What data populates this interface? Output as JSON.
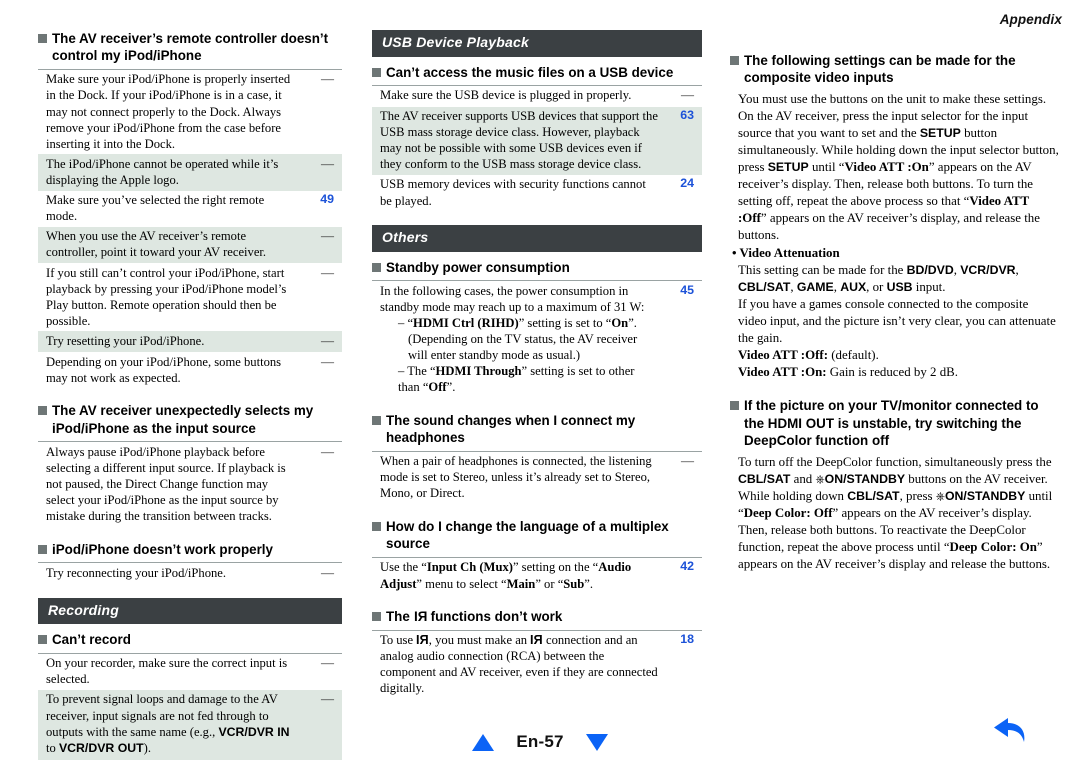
{
  "page": {
    "running_header": "Appendix",
    "page_label": "En-57",
    "nav_prev_icon": "triangle-up-icon",
    "nav_next_icon": "triangle-down-icon",
    "back_icon": "back-arrow-icon",
    "accent_blue": "#0b63f6",
    "ref_link_blue": "#1c52d8",
    "band_bg": "#3b4043",
    "row_shade": "#dee7e1",
    "bullet_square": "#6e7676"
  },
  "column1": {
    "q1": {
      "heading": "The AV receiver’s remote controller doesn’t control my iPod/iPhone",
      "rows": [
        {
          "text": "Make sure your iPod/iPhone is properly inserted in the Dock. If your iPod/iPhone is in a case, it may not connect properly to the Dock. Always remove your iPod/iPhone from the case before inserting it into the Dock.",
          "ref": "—",
          "shade": false
        },
        {
          "text": "The iPod/iPhone cannot be operated while it’s displaying the Apple logo.",
          "ref": "—",
          "shade": true
        },
        {
          "text": "Make sure you’ve selected the right remote mode.",
          "ref": "49",
          "shade": false
        },
        {
          "text": "When you use the AV receiver’s remote controller, point it toward your AV receiver.",
          "ref": "—",
          "shade": true
        },
        {
          "text": "If you still can’t control your iPod/iPhone, start playback by pressing your iPod/iPhone model’s Play button. Remote operation should then be possible.",
          "ref": "—",
          "shade": false
        },
        {
          "text": "Try resetting your iPod/iPhone.",
          "ref": "—",
          "shade": true
        },
        {
          "text": "Depending on your iPod/iPhone, some buttons may not work as expected.",
          "ref": "—",
          "shade": false
        }
      ]
    },
    "q2": {
      "heading": "The AV receiver unexpectedly selects my iPod/iPhone as the input source",
      "rows": [
        {
          "text": "Always pause iPod/iPhone playback before selecting a different input source. If playback is not paused, the Direct Change function may select your iPod/iPhone as the input source by mistake during the transition between tracks.",
          "ref": "—",
          "shade": false
        }
      ]
    },
    "q3": {
      "heading": "iPod/iPhone doesn’t work properly",
      "rows": [
        {
          "text": "Try reconnecting your iPod/iPhone.",
          "ref": "—",
          "shade": false
        }
      ]
    },
    "section_recording": "Recording",
    "q4": {
      "heading": "Can’t record",
      "rows": [
        {
          "text": "On your recorder, make sure the correct input is selected.",
          "ref": "—",
          "shade": false
        }
      ]
    },
    "q4_row2": {
      "prefix": "To prevent signal loops and damage to the AV receiver, input signals are not fed through to outputs with the same name (e.g., ",
      "bold1": "VCR/DVR IN",
      "mid": " to ",
      "bold2": "VCR/DVR OUT",
      "suffix": ").",
      "ref": "—"
    }
  },
  "column2": {
    "section_usb": "USB Device Playback",
    "q1": {
      "heading": "Can’t access the music files on a USB device",
      "rows": [
        {
          "text": "Make sure the USB device is plugged in properly.",
          "ref": "—",
          "shade": false
        },
        {
          "text": "The AV receiver supports USB devices that support the USB mass storage device class. However, playback may not be possible with some USB devices even if they conform to the USB mass storage device class.",
          "ref": "63",
          "shade": true
        },
        {
          "text": "USB memory devices with security functions cannot be played.",
          "ref": "24",
          "shade": false
        }
      ]
    },
    "section_others": "Others",
    "q2": {
      "heading": "Standby power consumption",
      "ref": "45",
      "line1": "In the following cases, the power consumption in standby mode may reach up to a maximum of 31 W:",
      "dash1_pre": "– “",
      "dash1_bold": "HDMI Ctrl (RIHD)",
      "dash1_post": "” setting is set to “",
      "dash1_bold2": "On",
      "dash1_end": "”.",
      "dash1_note": "(Depending on the TV status, the AV receiver will enter standby mode as usual.)",
      "dash2_pre": "– The “",
      "dash2_bold": "HDMI Through",
      "dash2_post": "” setting is set to other than “",
      "dash2_bold2": "Off",
      "dash2_end": "”."
    },
    "q3": {
      "heading": "The sound changes when I connect my headphones",
      "rows": [
        {
          "text": "When a pair of headphones is connected, the listening mode is set to Stereo, unless it’s already set to Stereo, Mono, or Direct.",
          "ref": "—",
          "shade": false
        }
      ]
    },
    "q4": {
      "heading": "How do I change the language of a multiplex source",
      "ref": "42",
      "pre": "Use the “",
      "bold1": "Input Ch (Mux)",
      "mid1": "” setting on the “",
      "bold2": "Audio Adjust",
      "mid2": "” menu to select “",
      "bold3": "Main",
      "mid3": "” or “",
      "bold4": "Sub",
      "end": "”."
    },
    "q5": {
      "heading_pre": "The ",
      "heading_logo": "RI",
      "heading_post": " functions don’t work",
      "ref": "18",
      "pre": "To use ",
      "logo1": "RI",
      "mid": ", you must make an ",
      "logo2": "RI",
      "post": " connection and an analog audio connection (RCA) between the component and AV receiver, even if they are connected digitally."
    }
  },
  "column3": {
    "q1": {
      "heading": "The following settings can be made for the composite video inputs",
      "p1": "You must use the buttons on the unit to make these settings.",
      "p2_a": "On the AV receiver, press the input selector for the input source that you want to set and the ",
      "p2_setup": "SETUP",
      "p2_b": " button simultaneously. While holding down the input selector button, press ",
      "p2_setup2": "SETUP",
      "p2_c": " until “",
      "p2_bold1": "Video ATT  :On",
      "p2_d": "” appears on the AV receiver’s display. Then, release both buttons. To turn the setting off, repeat the above process so that “",
      "p2_bold2": "Video ATT  :Off",
      "p2_e": "” appears on the AV receiver’s display, and release the buttons.",
      "sub_title": "• Video Attenuation",
      "p3_a": "This setting can be made for the ",
      "p3_b1": "BD/DVD",
      "p3_s1": ", ",
      "p3_b2": "VCR/DVR",
      "p3_s2": ", ",
      "p3_b3": "CBL/SAT",
      "p3_s3": ", ",
      "p3_b4": "GAME",
      "p3_s4": ", ",
      "p3_b5": "AUX",
      "p3_s5": ", or ",
      "p3_b6": "USB",
      "p3_end": " input.",
      "p4": "If you have a games console connected to the composite video input, and the picture isn’t very clear, you can attenuate the gain.",
      "p5_bold": "Video ATT  :Off:",
      "p5_rest": " (default).",
      "p6_bold": "Video ATT  :On:",
      "p6_rest": " Gain is reduced by 2 dB."
    },
    "q2": {
      "heading": "If the picture on your TV/monitor connected to the HDMI OUT is unstable, try switching the DeepColor function off",
      "p_a": "To turn off the DeepColor function, simultaneously press the ",
      "p_b1": "CBL/SAT",
      "p_c": " and ",
      "p_b2": "ON/STANDBY",
      "p_d": " buttons on the AV receiver. While holding down ",
      "p_b3": "CBL/SAT",
      "p_e": ", press ",
      "p_b4": "ON/STANDBY",
      "p_f": " until “",
      "p_b5": "Deep Color: Off",
      "p_g": "” appears on the AV receiver’s display. Then, release both buttons. To reactivate the DeepColor function, repeat the above process until “",
      "p_b6": "Deep Color: On",
      "p_h": "” appears on the AV receiver’s display and release the buttons."
    }
  }
}
